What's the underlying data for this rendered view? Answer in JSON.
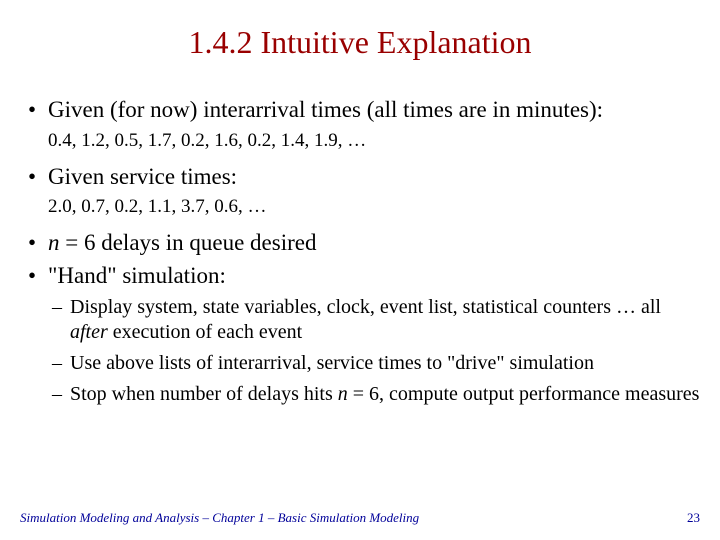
{
  "title": "1.4.2  Intuitive Explanation",
  "bullets": {
    "b1": "Given (for now) interarrival times (all times are in minutes):",
    "b1_sub": "0.4, 1.2, 0.5, 1.7, 0.2, 1.6, 0.2, 1.4, 1.9, …",
    "b2": "Given service times:",
    "b2_sub": "2.0, 0.7, 0.2, 1.1, 3.7, 0.6, …",
    "b3_var": "n",
    "b3_rest": " = 6 delays in queue desired",
    "b4": "\"Hand\" simulation:",
    "b4_s1a": "Display system, state variables, clock, event list, statistical counters … all ",
    "b4_s1_em": "after",
    "b4_s1b": " execution of each event",
    "b4_s2": "Use above lists of interarrival, service times to \"drive\" simulation",
    "b4_s3a": "Stop when number of delays hits ",
    "b4_s3_var": "n",
    "b4_s3b": " = 6, compute output performance measures"
  },
  "footer": {
    "book": "Simulation Modeling and Analysis",
    "sep1": " – ",
    "chapter": "Chapter 1 –  Basic Simulation Modeling",
    "page": "23"
  }
}
